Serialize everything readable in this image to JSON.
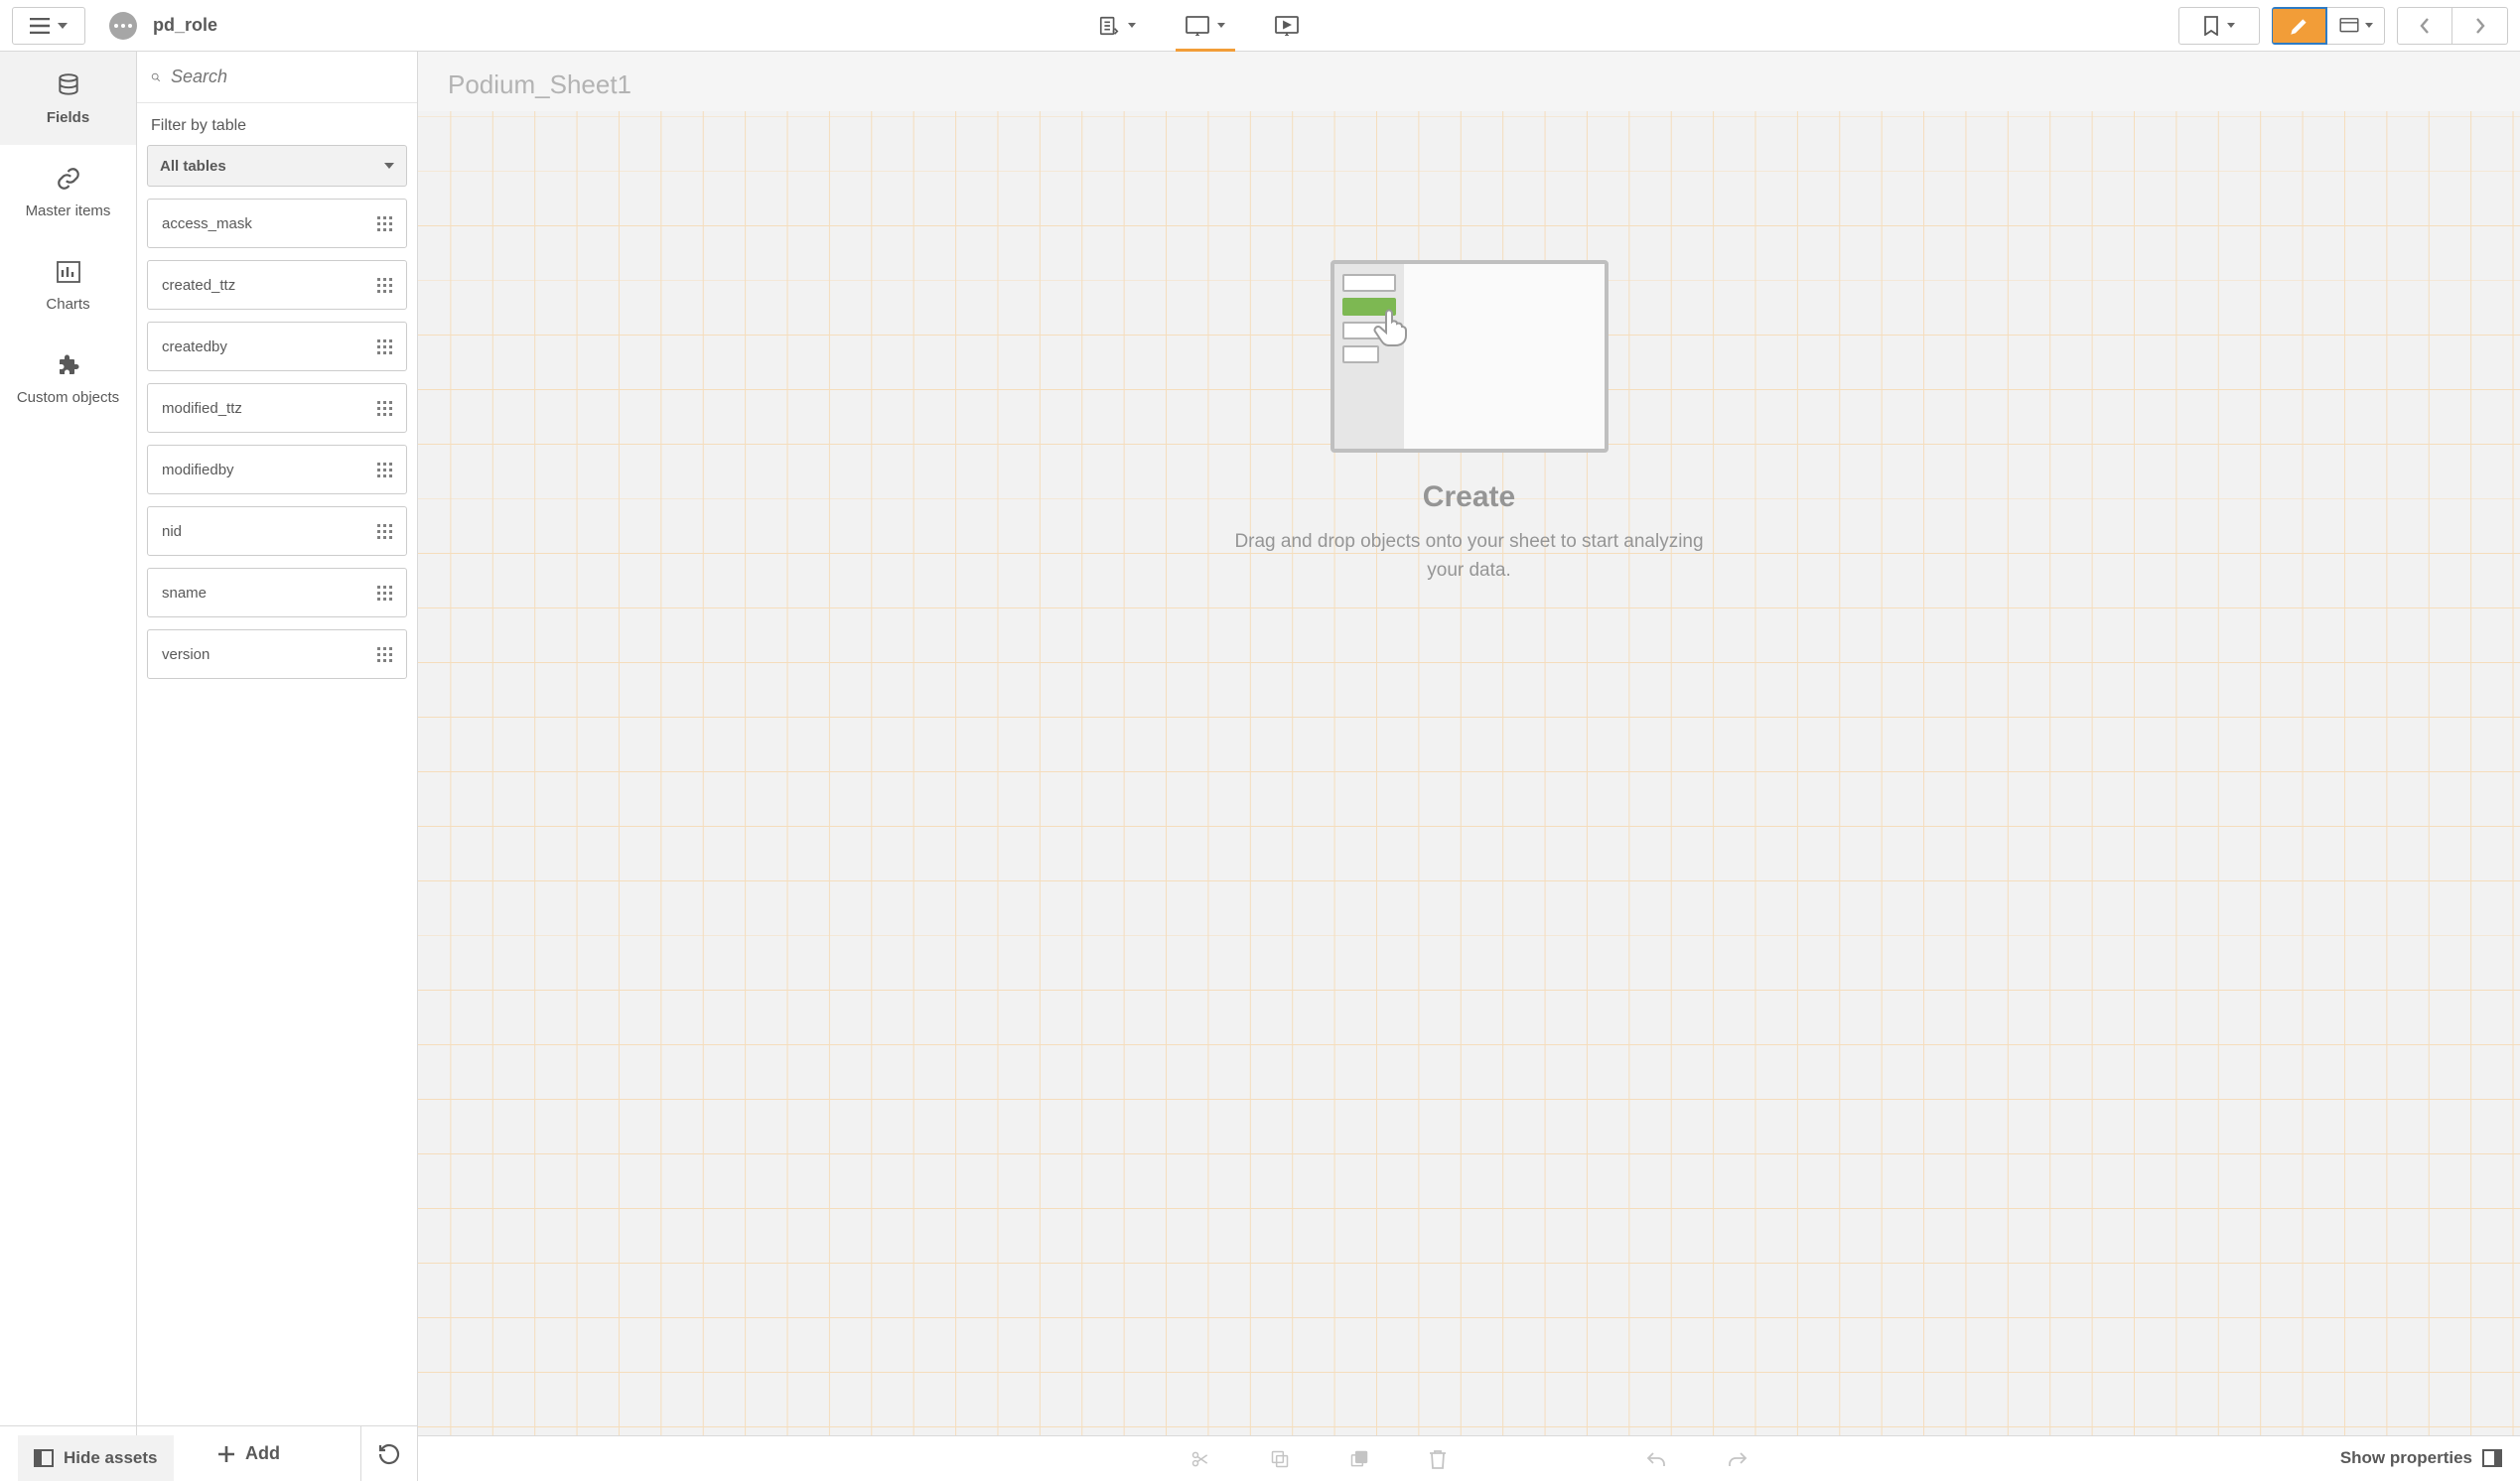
{
  "header": {
    "app_name": "pd_role"
  },
  "left_rail": {
    "fields": "Fields",
    "master_items": "Master items",
    "charts": "Charts",
    "custom_objects": "Custom objects"
  },
  "assets": {
    "search_placeholder": "Search",
    "filter_label": "Filter by table",
    "filter_value": "All tables",
    "fields": [
      "access_mask",
      "created_ttz",
      "createdby",
      "modified_ttz",
      "modifiedby",
      "nid",
      "sname",
      "version"
    ],
    "add_label": "Add"
  },
  "canvas": {
    "sheet_title": "Podium_Sheet1",
    "placeholder_title": "Create",
    "placeholder_sub": "Drag and drop objects onto your sheet to start analyzing your data."
  },
  "statusbar": {
    "hide_assets": "Hide assets",
    "show_properties": "Show properties"
  }
}
